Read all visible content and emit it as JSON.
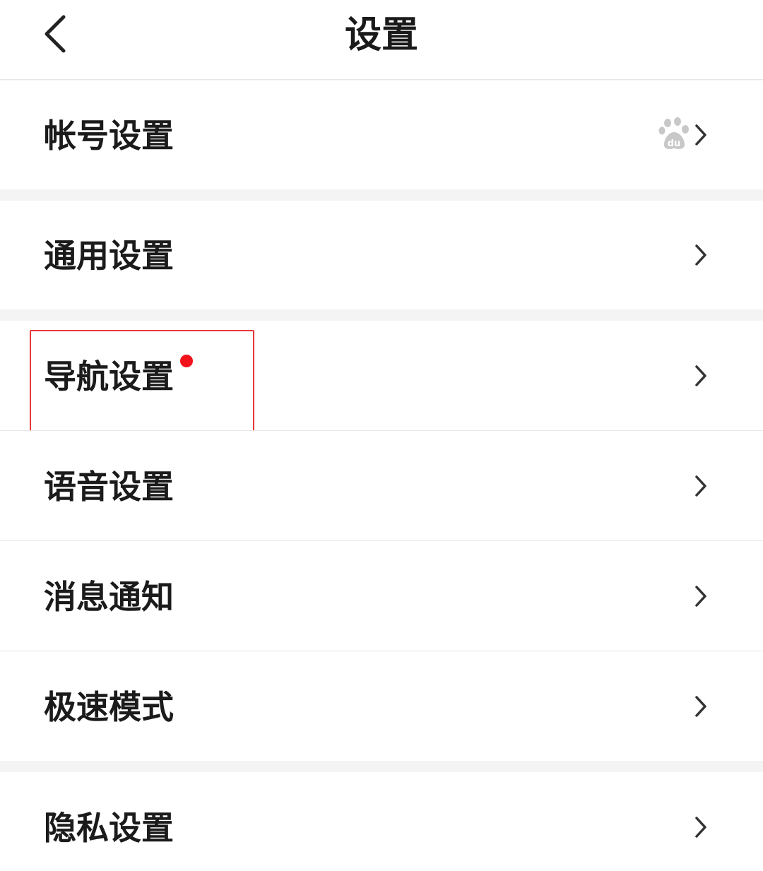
{
  "header": {
    "title": "设置",
    "back_icon": "chevron-left-icon"
  },
  "rows": [
    {
      "label": "帐号设置",
      "trailing_icon": "baidu-paw-icon"
    },
    {
      "label": "通用设置"
    },
    {
      "label": "导航设置",
      "badge": "red-dot",
      "badge_color": "#f2121b"
    },
    {
      "label": "语音设置"
    },
    {
      "label": "消息通知"
    },
    {
      "label": "极速模式"
    },
    {
      "label": "隐私设置"
    }
  ],
  "chevron_icon": "chevron-right-icon",
  "colors": {
    "background": "#f4f4f4",
    "row_background": "#ffffff",
    "highlight": "#e63a3a"
  }
}
